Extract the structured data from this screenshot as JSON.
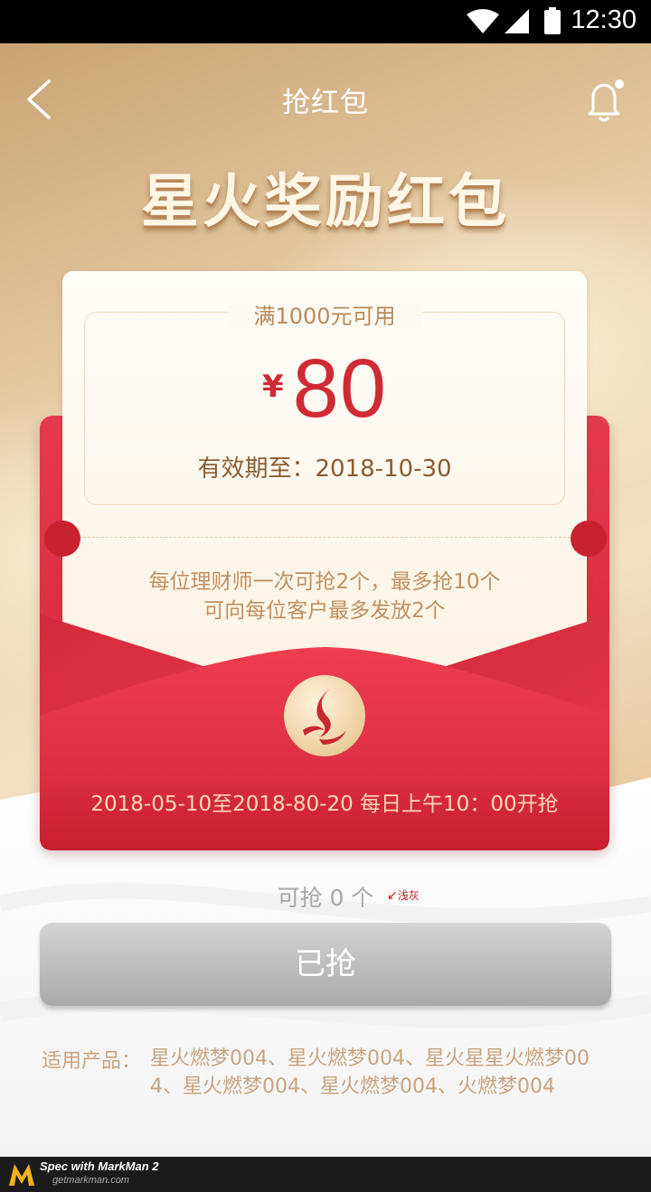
{
  "status_bar": {
    "time": "12:30"
  },
  "nav": {
    "title": "抢红包"
  },
  "hero": {
    "title": "星火奖励红包"
  },
  "coupon": {
    "condition": "满1000元可用",
    "currency": "¥",
    "amount": "80",
    "valid_until": "有效期至：2018-10-30",
    "rule_line1": "每位理财师一次可抢2个，最多抢10个",
    "rule_line2": "可向每位客户最多发放2个"
  },
  "envelope": {
    "period": "2018-05-10至2018-80-20 每日上午10：00开抢"
  },
  "remaining": {
    "text": "可抢 0 个",
    "note": "浅灰"
  },
  "action": {
    "button_label": "已抢"
  },
  "products": {
    "label": "适用产品：",
    "list": "星火燃梦004、星火燃梦004、星火星星火燃梦004、星火燃梦004、星火燃梦004、火燃梦004"
  },
  "watermark": {
    "brand": "Spec with MarkMan 2",
    "url": "getmarkman.com"
  },
  "colors": {
    "red": "#d92d41",
    "gold": "#e2c293",
    "disabled_button": "#bcbcbc"
  }
}
